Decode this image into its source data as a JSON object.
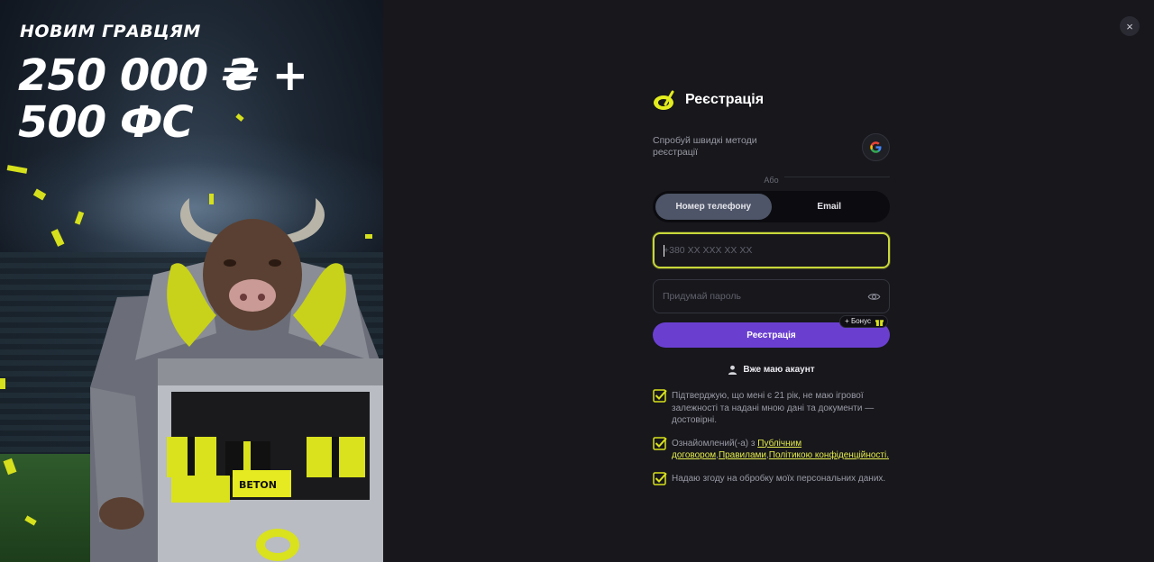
{
  "promo": {
    "title": "НОВИМ ГРАВЦЯМ",
    "amount": "250 000 ₴ +",
    "freespins": "500 ФС",
    "chest_brand": "BETON"
  },
  "close": {
    "label": "×"
  },
  "form": {
    "title": "Реєстрація",
    "quick_methods_text": "Спробуй швидкі методи реєстрації",
    "or_text": "Або",
    "tabs": [
      {
        "label": "Номер телефону",
        "active": true
      },
      {
        "label": "Email",
        "active": false
      }
    ],
    "phone_placeholder": "+380 XX XXX XX XX",
    "password_placeholder": "Придумай пароль",
    "submit_label": "Реєстрація",
    "bonus_label": "+ Бонус",
    "have_account_label": "Вже маю акаунт",
    "consents": [
      {
        "text": "Підтверджую, що мені є 21 рік, не маю ігрової залежності та надані мною дані та документи — достовірні.",
        "checked": true
      },
      {
        "prefix": "Ознайомлений(-а) з ",
        "links": [
          "Публічним договором",
          "Правилами",
          "Політикою конфіденційності."
        ],
        "checked": true
      },
      {
        "text": "Надаю згоду на обробку моїх персональних даних.",
        "checked": true
      }
    ]
  },
  "colors": {
    "accent_lime": "#c9d83a",
    "accent_purple": "#6a3fd0",
    "background": "#17171c"
  }
}
